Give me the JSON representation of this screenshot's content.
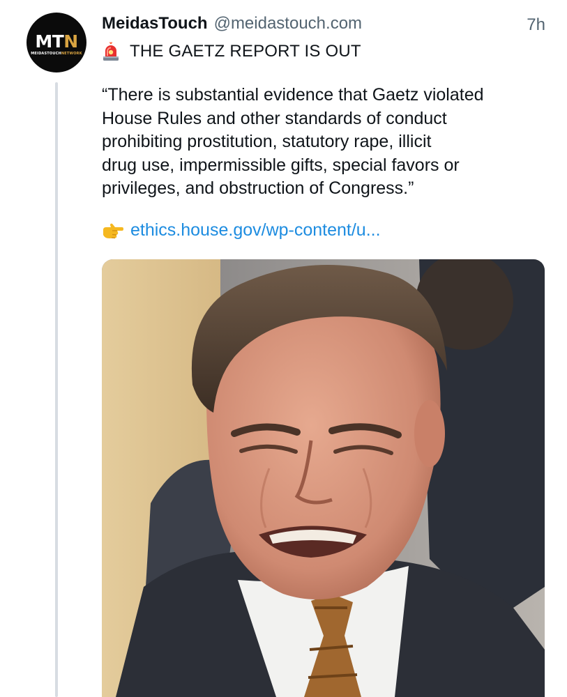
{
  "post": {
    "avatar": {
      "mark_left": "MT",
      "mark_right": "N",
      "sub_left": "MEIDASTOUCH",
      "sub_right": "NETWORK"
    },
    "author": {
      "display_name": "MeidasTouch",
      "handle": "@meidastouch.com"
    },
    "timestamp": "7h",
    "headline": {
      "icon": "police-siren-emoji",
      "text": "THE GAETZ REPORT IS OUT"
    },
    "quote_lines": [
      "“There is substantial evidence that Gaetz violated",
      "House Rules and other standards of conduct",
      "prohibiting prostitution, statutory rape, illicit",
      "drug use, impermissible gifts, special favors or",
      "privileges, and obstruction of Congress.”"
    ],
    "link": {
      "icon": "pointing-right-hand-emoji",
      "text": "ethics.house.gov/wp-content/u..."
    },
    "media": {
      "kind": "photo",
      "subject": "man-grimacing-portrait"
    }
  },
  "colors": {
    "text_primary": "#0f1419",
    "text_secondary": "#536471",
    "link": "#1d8ce0",
    "thread_line": "#d7dce2",
    "avatar_bg": "#0b0b0b",
    "avatar_accent": "#d9a441"
  }
}
